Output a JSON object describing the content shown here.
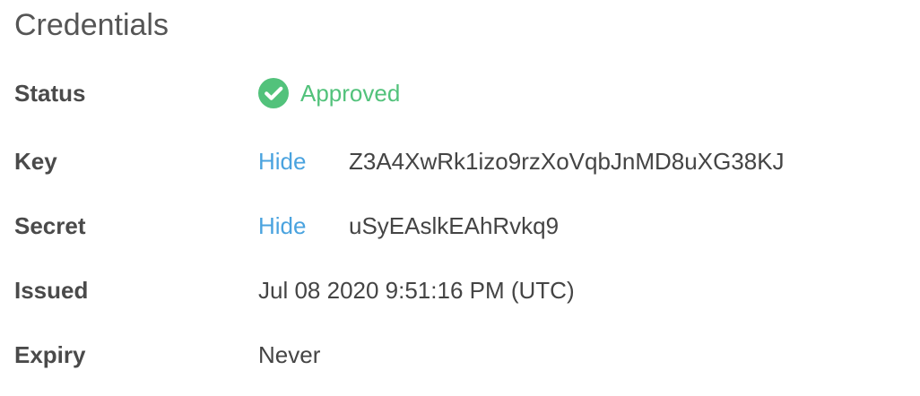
{
  "title": "Credentials",
  "colors": {
    "approved": "#52c27b",
    "link": "#4aa3df",
    "label": "#4a4a4a",
    "text": "#444444"
  },
  "status": {
    "label": "Status",
    "icon": "check-circle-icon",
    "value": "Approved"
  },
  "key": {
    "label": "Key",
    "toggle": "Hide",
    "value": "Z3A4XwRk1izo9rzXoVqbJnMD8uXG38KJ"
  },
  "secret": {
    "label": "Secret",
    "toggle": "Hide",
    "value": "uSyEAslkEAhRvkq9"
  },
  "issued": {
    "label": "Issued",
    "value": "Jul 08 2020 9:51:16 PM (UTC)"
  },
  "expiry": {
    "label": "Expiry",
    "value": "Never"
  }
}
